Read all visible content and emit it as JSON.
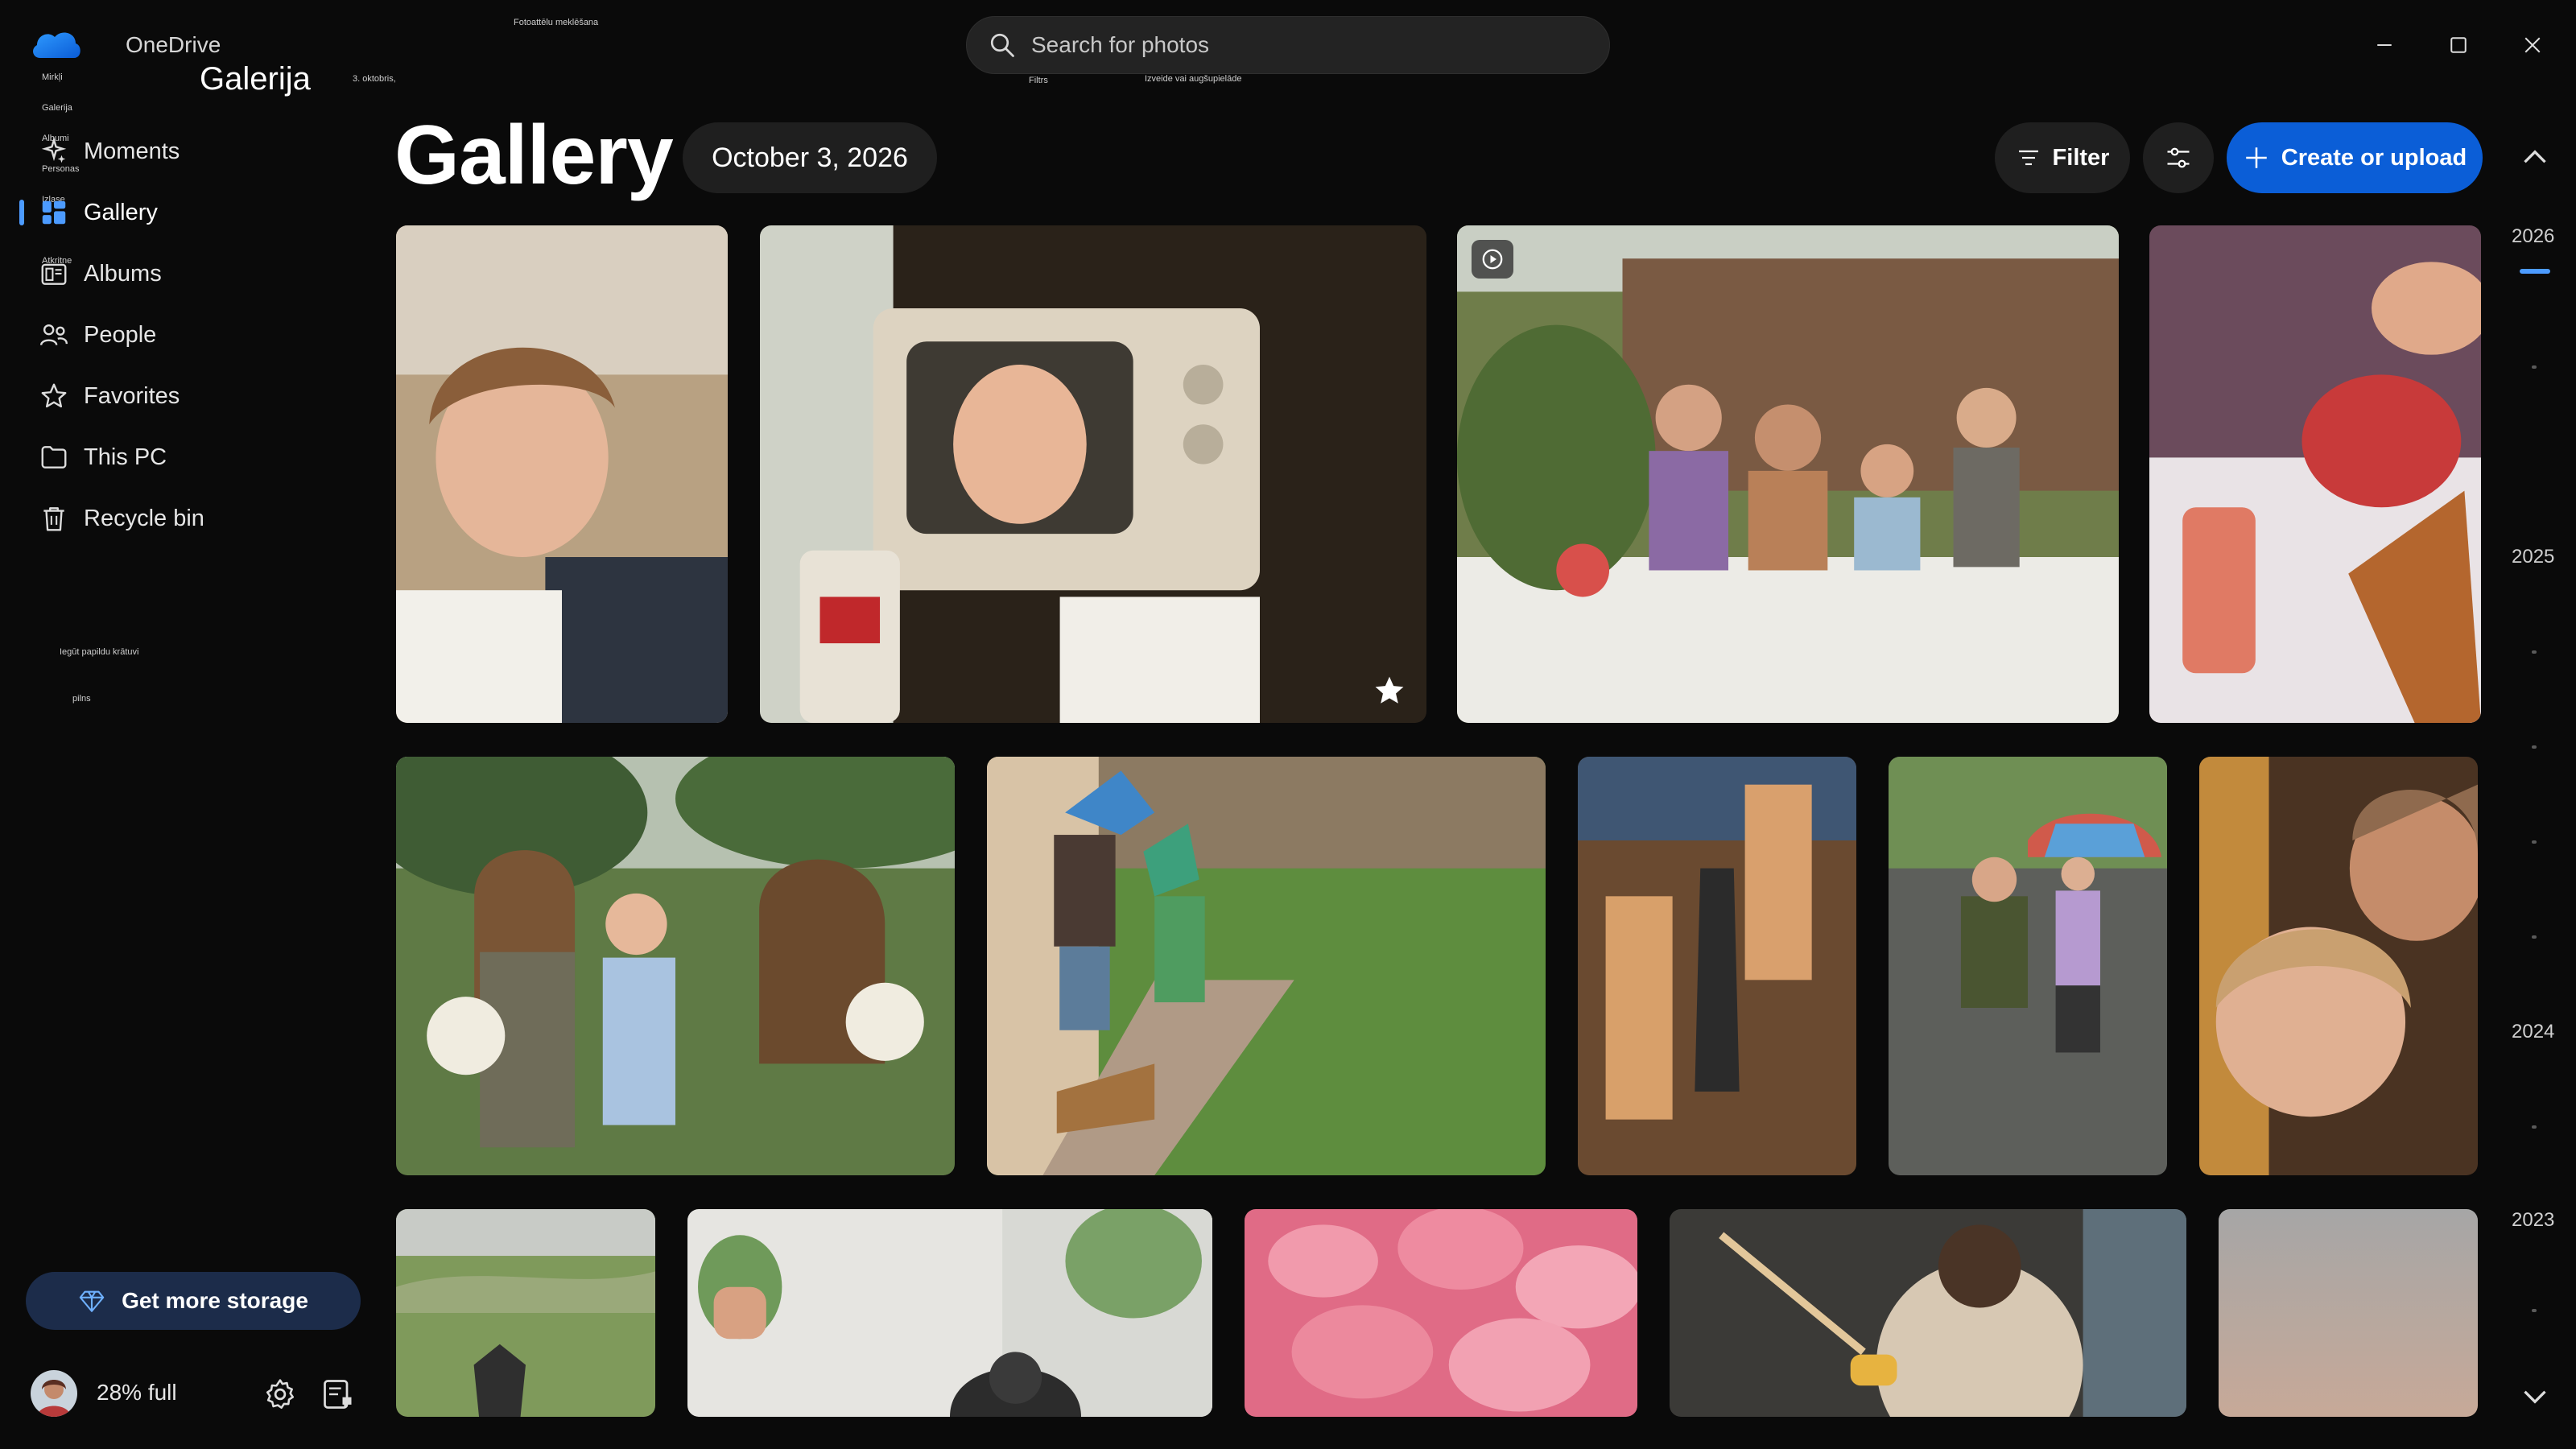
{
  "app": {
    "name": "OneDrive",
    "name_lv": "Galerija",
    "date_lv": "3. oktobris,"
  },
  "tiny_labels": {
    "search_hint": "Fotoattēlu meklēšana",
    "filter_hint": "Filtrs",
    "create_hint": "Izveide vai augšupielāde",
    "recent": "Mirkļi",
    "gallery": "Galerija",
    "albums": "Albumi",
    "people": "Personas",
    "this_pc": "Izlase",
    "recycle": "Atkritne",
    "get_storage": "Iegūt papildu krātuvi",
    "full": "pilns"
  },
  "search": {
    "placeholder": "Search for photos"
  },
  "sidebar": {
    "items": [
      {
        "label": "Moments",
        "icon": "moments-icon"
      },
      {
        "label": "Gallery",
        "icon": "gallery-icon",
        "selected": true
      },
      {
        "label": "Albums",
        "icon": "albums-icon"
      },
      {
        "label": "People",
        "icon": "people-icon"
      },
      {
        "label": "Favorites",
        "icon": "star-icon"
      },
      {
        "label": "This PC",
        "icon": "folder-icon"
      },
      {
        "label": "Recycle bin",
        "icon": "trash-icon"
      }
    ],
    "storage_button": "Get more storage",
    "storage_status": "28% full"
  },
  "header": {
    "title": "Gallery",
    "date": "October 3, 2026",
    "filter_label": "Filter",
    "create_label": "Create or upload"
  },
  "timeline": {
    "years": [
      "2026",
      "2025",
      "2024",
      "2023"
    ]
  },
  "colors": {
    "accent": "#0b5ed7",
    "indicator": "#4c9bff",
    "background": "#0a0a0a"
  }
}
